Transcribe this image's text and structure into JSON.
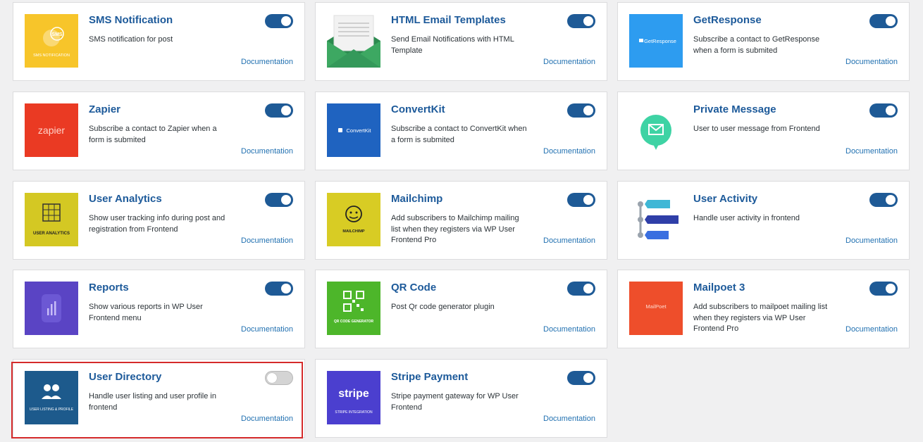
{
  "doc_label": "Documentation",
  "modules": [
    {
      "title": "SMS Notification",
      "desc": "SMS notification for post",
      "enabled": true,
      "icon": "sms-notification-icon",
      "thumb_text": "SMS NOTIFICATION",
      "badge": "SMS",
      "color": "#f7c52a"
    },
    {
      "title": "HTML Email Templates",
      "desc": "Send Email Notifications with HTML Template",
      "enabled": true,
      "icon": "envelope-icon",
      "color": "#ffffff"
    },
    {
      "title": "GetResponse",
      "desc": "Subscribe a contact to GetResponse when a form is submited",
      "enabled": true,
      "icon": "getresponse-icon",
      "thumb_text": "GetResponse",
      "color": "#2d9cf0"
    },
    {
      "title": "Zapier",
      "desc": "Subscribe a contact to Zapier when a form is submited",
      "enabled": true,
      "icon": "zapier-icon",
      "thumb_text": "zapier",
      "color": "#ea3a23"
    },
    {
      "title": "ConvertKit",
      "desc": "Subscribe a contact to ConvertKit when a form is submited",
      "enabled": true,
      "icon": "convertkit-icon",
      "thumb_text": "ConvertKit",
      "color": "#1f63c0"
    },
    {
      "title": "Private Message",
      "desc": "User to user message from Frontend",
      "enabled": true,
      "icon": "chat-bubble-icon",
      "color": "#ffffff"
    },
    {
      "title": "User Analytics",
      "desc": "Show user tracking info during post and registration from Frontend",
      "enabled": true,
      "icon": "user-analytics-icon",
      "thumb_text": "USER ANALYTICS",
      "color": "#d4c823"
    },
    {
      "title": "Mailchimp",
      "desc": "Add subscribers to Mailchimp mailing list when they registers via WP User Frontend Pro",
      "enabled": true,
      "icon": "mailchimp-icon",
      "thumb_text": "MAILCHIMP",
      "color": "#d8cc24"
    },
    {
      "title": "User Activity",
      "desc": "Handle user activity in frontend",
      "enabled": true,
      "icon": "user-activity-icon",
      "color": "#ffffff"
    },
    {
      "title": "Reports",
      "desc": "Show various reports in WP User Frontend menu",
      "enabled": true,
      "icon": "reports-icon",
      "color": "#5a44c4"
    },
    {
      "title": "QR Code",
      "desc": "Post Qr code generator plugin",
      "enabled": true,
      "icon": "qr-code-icon",
      "thumb_text": "QR CODE GENERATOR",
      "color": "#4db62a"
    },
    {
      "title": "Mailpoet 3",
      "desc": "Add subscribers to mailpoet mailing list when they registers via WP User Frontend Pro",
      "enabled": true,
      "icon": "mailpoet-icon",
      "thumb_text": "MailPoet",
      "color": "#ee4e2b"
    },
    {
      "title": "User Directory",
      "desc": "Handle user listing and user profile in frontend",
      "enabled": false,
      "icon": "user-directory-icon",
      "thumb_text": "USER LISTING & PROFILE",
      "color": "#1d5a8c"
    },
    {
      "title": "Stripe Payment",
      "desc": "Stripe payment gateway for WP User Frontend",
      "enabled": true,
      "icon": "stripe-icon",
      "thumb_text": "STRIPE INTEGRATION",
      "badge": "stripe",
      "color": "#4b3fcf"
    }
  ]
}
